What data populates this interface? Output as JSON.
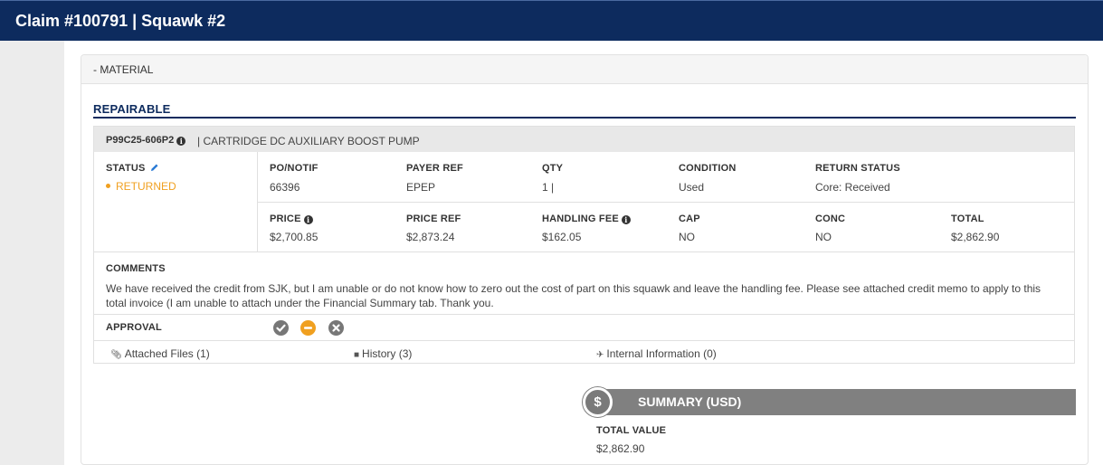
{
  "header": {
    "title": "Claim #100791 | Squawk #2"
  },
  "panel": {
    "toggle_label": "- MATERIAL"
  },
  "section": {
    "title": "REPAIRABLE"
  },
  "part": {
    "number": "P99C25-606P2",
    "description": "| CARTRIDGE DC AUXILIARY BOOST PUMP",
    "status_label": "STATUS",
    "status_value": "RETURNED",
    "status_color": "#f0a020",
    "row1": [
      {
        "label": "PO/NOTIF",
        "value": "66396"
      },
      {
        "label": "PAYER REF",
        "value": "EPEP"
      },
      {
        "label": "QTY",
        "value": "1 |"
      },
      {
        "label": "CONDITION",
        "value": "Used"
      },
      {
        "label": "RETURN STATUS",
        "value": "Core: Received"
      }
    ],
    "row2": [
      {
        "label": "PRICE",
        "value": "$2,700.85",
        "info": true
      },
      {
        "label": "PRICE REF",
        "value": "$2,873.24"
      },
      {
        "label": "HANDLING FEE",
        "value": "$162.05",
        "info": true
      },
      {
        "label": "CAP",
        "value": "NO"
      },
      {
        "label": "CONC",
        "value": "NO"
      },
      {
        "label": "TOTAL",
        "value": "$2,862.90"
      }
    ],
    "comments_label": "COMMENTS",
    "comments_text": "We have received the credit from SJK, but I am unable or do not know how to zero out the cost of part on this squawk and leave the handling fee. Please see attached credit memo to apply to this total invoice (I am unable to attach under the Financial Summary tab. Thank you.",
    "approval_label": "APPROVAL",
    "approval_buttons": [
      {
        "icon": "check-icon",
        "color": "#777777"
      },
      {
        "icon": "minus-icon",
        "color": "#f0a020"
      },
      {
        "icon": "x-icon",
        "color": "#777777"
      }
    ],
    "links": [
      {
        "icon": "paperclip-icon",
        "label": "Attached Files (1)"
      },
      {
        "icon": "book-icon",
        "label": "History (3)"
      },
      {
        "icon": "plane-icon",
        "label": "Internal Information (0)"
      }
    ]
  },
  "summary": {
    "title": "SUMMARY (USD)",
    "total_label": "TOTAL VALUE",
    "total_value": "$2,862.90"
  }
}
